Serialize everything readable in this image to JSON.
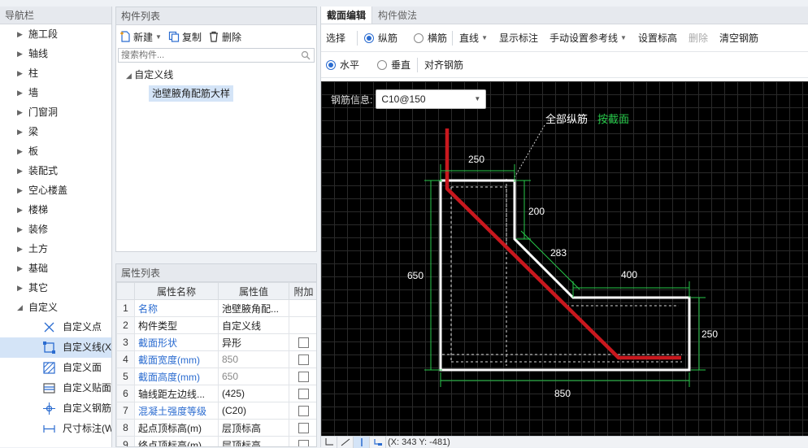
{
  "nav": {
    "title": "导航栏",
    "items": [
      {
        "label": "施工段"
      },
      {
        "label": "轴线"
      },
      {
        "label": "柱"
      },
      {
        "label": "墙"
      },
      {
        "label": "门窗洞"
      },
      {
        "label": "梁"
      },
      {
        "label": "板"
      },
      {
        "label": "装配式"
      },
      {
        "label": "空心楼盖"
      },
      {
        "label": "楼梯"
      },
      {
        "label": "装修"
      },
      {
        "label": "土方"
      },
      {
        "label": "基础"
      },
      {
        "label": "其它"
      }
    ],
    "expanded": {
      "label": "自定义"
    },
    "subitems": [
      {
        "label": "自定义点",
        "icon": "custom-point-icon"
      },
      {
        "label": "自定义线(X",
        "icon": "custom-line-icon"
      },
      {
        "label": "自定义面",
        "icon": "custom-face-icon"
      },
      {
        "label": "自定义贴面",
        "icon": "custom-veneer-icon"
      },
      {
        "label": "自定义钢筋",
        "icon": "custom-rebar-icon"
      },
      {
        "label": "尺寸标注(W",
        "icon": "dimension-icon"
      }
    ]
  },
  "components": {
    "title": "构件列表",
    "new_label": "新建",
    "copy_label": "复制",
    "delete_label": "删除",
    "search_placeholder": "搜索构件...",
    "root": "自定义线",
    "child": "池壁腋角配筋大样"
  },
  "properties": {
    "title": "属性列表",
    "headers": [
      "",
      "属性名称",
      "属性值",
      "附加"
    ],
    "rows": [
      {
        "n": "1",
        "name": "名称",
        "value": "池壁腋角配...",
        "blue": true,
        "gray": false,
        "check": false
      },
      {
        "n": "2",
        "name": "构件类型",
        "value": "自定义线",
        "blue": false,
        "gray": false,
        "check": false
      },
      {
        "n": "3",
        "name": "截面形状",
        "value": "异形",
        "blue": true,
        "gray": false,
        "check": true
      },
      {
        "n": "4",
        "name": "截面宽度(mm)",
        "value": "850",
        "blue": true,
        "gray": true,
        "check": true
      },
      {
        "n": "5",
        "name": "截面高度(mm)",
        "value": "650",
        "blue": true,
        "gray": true,
        "check": true
      },
      {
        "n": "6",
        "name": "轴线距左边线...",
        "value": "(425)",
        "blue": false,
        "gray": false,
        "check": true
      },
      {
        "n": "7",
        "name": "混凝土强度等级",
        "value": "(C20)",
        "blue": true,
        "gray": false,
        "check": true
      },
      {
        "n": "8",
        "name": "起点顶标高(m)",
        "value": "层顶标高",
        "blue": false,
        "gray": false,
        "check": true
      },
      {
        "n": "9",
        "name": "终点顶标高(m)",
        "value": "层顶标高",
        "blue": false,
        "gray": false,
        "check": true
      }
    ]
  },
  "editor": {
    "tabs": [
      "截面编辑",
      "构件做法"
    ],
    "toolbar1": {
      "select": "选择",
      "longitudinal": "纵筋",
      "transverse": "横筋",
      "line": "直线",
      "show_label": "显示标注",
      "manual_ref": "手动设置参考线",
      "set_elev": "设置标高",
      "delete": "删除",
      "clear": "清空钢筋"
    },
    "toolbar2": {
      "horizontal": "水平",
      "vertical": "垂直",
      "align": "对齐钢筋"
    },
    "rebar_info_label": "钢筋信息:",
    "rebar_info_value": "C10@150",
    "annotation_white": "全部纵筋",
    "annotation_green": "按截面",
    "dims": {
      "top": "250",
      "right_top": "200",
      "diag": "283",
      "right_mid": "400",
      "left": "650",
      "right": "250",
      "bottom": "850"
    },
    "coords": "(X: 343 Y: -481)"
  },
  "colors": {
    "rebar": "#c8181e",
    "dim": "#27c94a",
    "section": "#ffffff"
  }
}
